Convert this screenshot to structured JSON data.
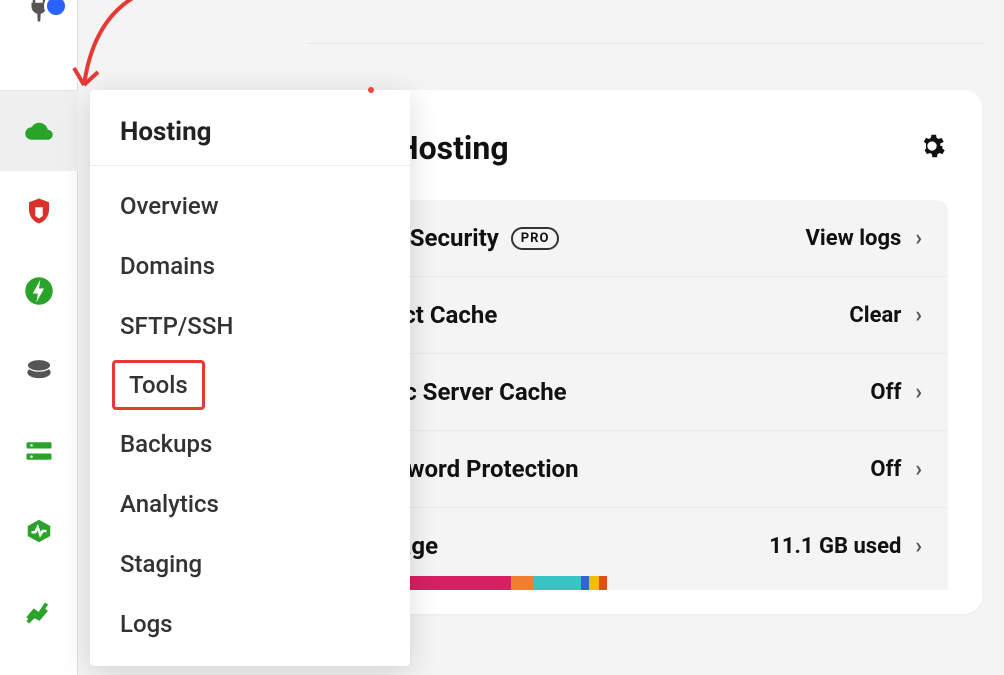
{
  "flyout": {
    "header": "Hosting",
    "items": [
      {
        "label": "Overview",
        "highlight": false
      },
      {
        "label": "Domains",
        "highlight": false
      },
      {
        "label": "SFTP/SSH",
        "highlight": false
      },
      {
        "label": "Tools",
        "highlight": true
      },
      {
        "label": "Backups",
        "highlight": false
      },
      {
        "label": "Analytics",
        "highlight": false
      },
      {
        "label": "Staging",
        "highlight": false
      },
      {
        "label": "Logs",
        "highlight": false
      }
    ]
  },
  "card": {
    "title": "Hosting"
  },
  "rows": [
    {
      "label": "WAF Security",
      "badge": "PRO",
      "value": "View logs"
    },
    {
      "label": "Object Cache",
      "badge": null,
      "value": "Clear"
    },
    {
      "label": "Static Server Cache",
      "badge": null,
      "value": "Off"
    },
    {
      "label": "Password Protection",
      "badge": null,
      "value": "Off"
    },
    {
      "label": "Storage",
      "badge": null,
      "value": "11.1 GB used"
    }
  ],
  "rail_icons": [
    "plug-icon",
    "cloud-icon",
    "shield-icon",
    "bolt-icon",
    "disc-icon",
    "server-icon",
    "heartbeat-icon",
    "chart-icon"
  ],
  "storage_segments": [
    {
      "color": "#d72060",
      "w": 41
    },
    {
      "color": "#f08030",
      "w": 9
    },
    {
      "color": "#36c5c0",
      "w": 18
    },
    {
      "color": "#3366cc",
      "w": 3
    },
    {
      "color": "#f0c000",
      "w": 4
    },
    {
      "color": "#e64a19",
      "w": 3
    }
  ]
}
